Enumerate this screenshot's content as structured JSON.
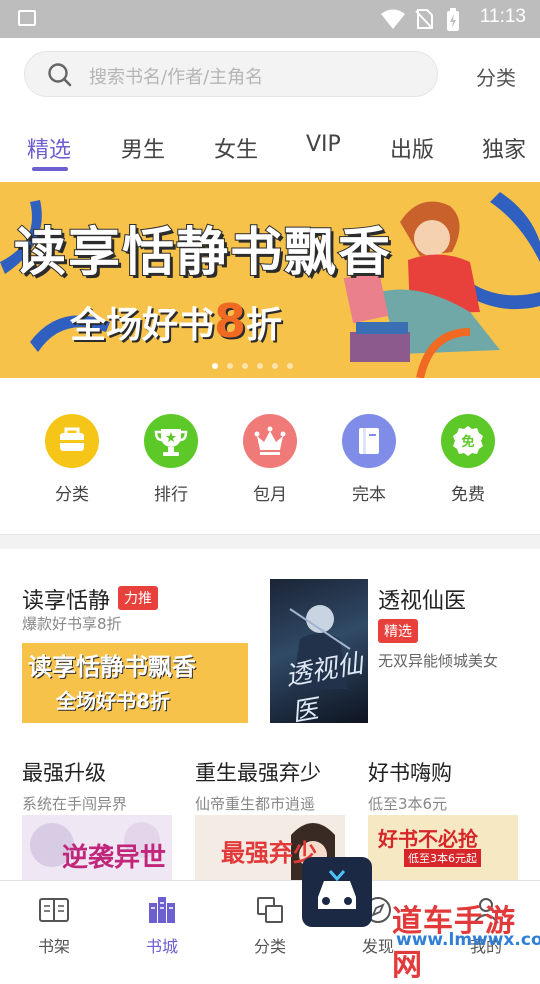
{
  "status_bar": {
    "time": "11:13"
  },
  "search": {
    "placeholder": "搜索书名/作者/主角名",
    "category_link": "分类"
  },
  "tabs": [
    {
      "label": "精选",
      "active": true
    },
    {
      "label": "男生",
      "active": false
    },
    {
      "label": "女生",
      "active": false
    },
    {
      "label": "VIP",
      "active": false
    },
    {
      "label": "出版",
      "active": false
    },
    {
      "label": "独家",
      "active": false
    }
  ],
  "banner": {
    "headline": "读享恬静书飘香",
    "sub_prefix": "全场好书",
    "sub_number": "8",
    "sub_suffix": "折",
    "active_dot": 1,
    "dot_count": 6
  },
  "quick_links": [
    {
      "label": "分类",
      "color": "#f5c518",
      "icon": "bag-icon"
    },
    {
      "label": "排行",
      "color": "#5cc928",
      "icon": "trophy-icon"
    },
    {
      "label": "包月",
      "color": "#f07a78",
      "icon": "crown-icon"
    },
    {
      "label": "完本",
      "color": "#7f8de8",
      "icon": "book-icon"
    },
    {
      "label": "免费",
      "color": "#5cc928",
      "icon": "free-tag-icon"
    }
  ],
  "featured_left": {
    "title": "读享恬静",
    "badge": "力推",
    "subtitle": "爆款好书享8折",
    "banner_line1": "读享恬静书飘香",
    "banner_line2": "全场好书8折"
  },
  "featured_right": {
    "title": "透视仙医",
    "badge": "精选",
    "desc": "无双异能倾城美女",
    "cover_title": "透视仙医"
  },
  "recommendations": [
    {
      "title": "最强升级",
      "subtitle": "系统在手闯异界",
      "cover_text": "逆袭异世"
    },
    {
      "title": "重生最强弃少",
      "subtitle": "仙帝重生都市逍遥",
      "cover_text": "最强弃少"
    },
    {
      "title": "好书嗨购",
      "subtitle": "低至3本6元",
      "cover_text": "好书不必抢",
      "cover_sub": "低至3本6元起"
    }
  ],
  "bottom_nav": [
    {
      "label": "书架",
      "icon": "bookshelf-icon",
      "active": false
    },
    {
      "label": "书城",
      "icon": "bookstore-icon",
      "active": true
    },
    {
      "label": "分类",
      "icon": "category-icon",
      "active": false
    },
    {
      "label": "发现",
      "icon": "compass-icon",
      "active": false
    },
    {
      "label": "我的",
      "icon": "profile-icon",
      "active": false
    }
  ],
  "watermark": {
    "title": "道车手游网",
    "url": "www.lmwwx.com"
  },
  "colors": {
    "accent": "#6c5fd0",
    "badge_red": "#e8413c",
    "banner_yellow": "#f7c24a"
  }
}
